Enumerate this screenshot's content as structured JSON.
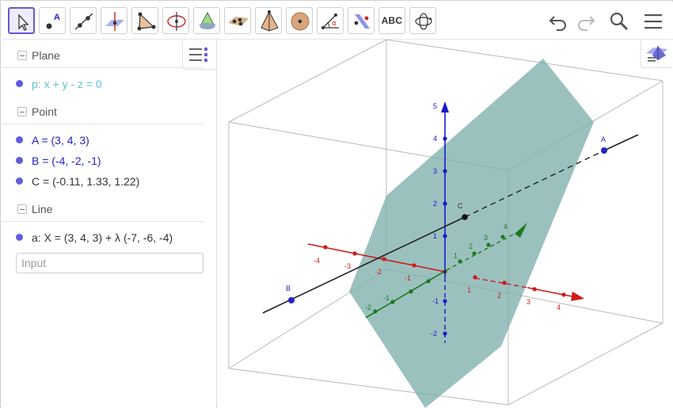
{
  "toolbar": {
    "tools": [
      {
        "id": "move",
        "icon": "cursor-arrow-icon",
        "active": true
      },
      {
        "id": "point",
        "icon": "point-icon"
      },
      {
        "id": "line",
        "icon": "line-icon"
      },
      {
        "id": "perpendicular",
        "icon": "perpendicular-icon"
      },
      {
        "id": "polygon",
        "icon": "triangle-icon"
      },
      {
        "id": "circle-axis",
        "icon": "circle-around-axis-icon"
      },
      {
        "id": "intersect",
        "icon": "intersect-icon"
      },
      {
        "id": "plane",
        "icon": "plane-icon"
      },
      {
        "id": "pyramid",
        "icon": "pyramid-icon"
      },
      {
        "id": "sphere",
        "icon": "sphere-icon"
      },
      {
        "id": "angle",
        "icon": "angle-icon"
      },
      {
        "id": "reflect",
        "icon": "reflect-plane-icon"
      },
      {
        "id": "text",
        "icon": "text-icon",
        "label": "ABC"
      },
      {
        "id": "rotate-view",
        "icon": "rotate-view-icon"
      }
    ],
    "undo_icon": "undo-icon",
    "redo_icon": "redo-icon",
    "search_icon": "search-icon",
    "menu_icon": "hamburger-menu-icon"
  },
  "algebra": {
    "groups": [
      {
        "title": "Plane",
        "items": [
          {
            "text": "p: x + y - z = 0",
            "color": "#5bbfd0"
          }
        ]
      },
      {
        "title": "Point",
        "items": [
          {
            "text": "A = (3, 4, 3)",
            "color": "#2323c9"
          },
          {
            "text": "B = (-4, -2, -1)",
            "color": "#2323c9"
          },
          {
            "text": "C = (-0.11, 1.33, 1.22)",
            "color": "#333333"
          }
        ]
      },
      {
        "title": "Line",
        "items": [
          {
            "text": "a: X = (3, 4, 3) + λ (-7, -6, -4)",
            "color": "#333333"
          }
        ]
      }
    ],
    "input_placeholder": "Input"
  },
  "graphics": {
    "point_labels": {
      "A": "A",
      "B": "B",
      "C": "C"
    },
    "x_ticks": [
      "-4",
      "-3",
      "-2",
      "-1",
      "1",
      "2",
      "3",
      "4"
    ],
    "y_ticks": [
      "-2",
      "-1",
      "1",
      "2",
      "3",
      "4"
    ],
    "z_ticks": [
      "-2",
      "-1",
      "1",
      "2",
      "3",
      "4",
      "5"
    ],
    "colors": {
      "x_axis": "#d01a1a",
      "y_axis": "#1d7a1d",
      "z_axis": "#1a1ac9",
      "plane": "#7fb0ad",
      "accent": "#6557d2"
    }
  }
}
